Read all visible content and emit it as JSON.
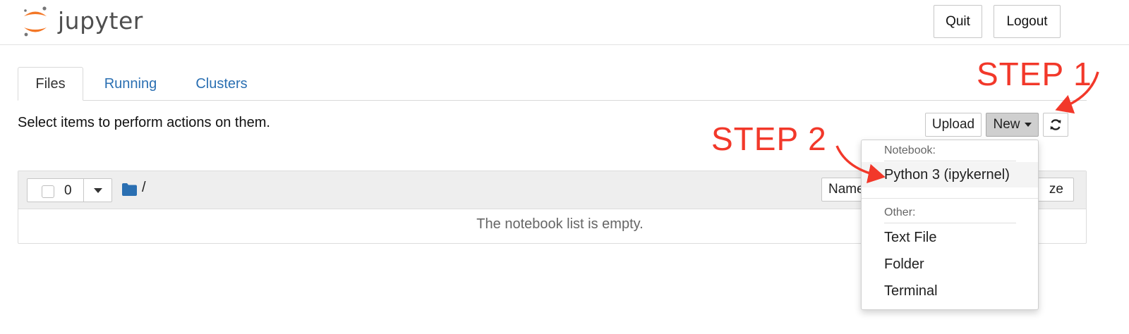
{
  "header": {
    "logo_text": "jupyter",
    "quit_label": "Quit",
    "logout_label": "Logout"
  },
  "tabs": [
    {
      "label": "Files"
    },
    {
      "label": "Running"
    },
    {
      "label": "Clusters"
    }
  ],
  "toolbar": {
    "instructions": "Select items to perform actions on them.",
    "upload_label": "Upload",
    "new_label": "New",
    "refresh_icon": "refresh-icon"
  },
  "file_list": {
    "selected_count": "0",
    "path": "/",
    "sort_name_label": "Name",
    "sort_size_label": "ze",
    "empty_message": "The notebook list is empty."
  },
  "new_menu": {
    "notebook_header": "Notebook:",
    "notebook_items": [
      "Python 3 (ipykernel)"
    ],
    "other_header": "Other:",
    "other_items": [
      "Text File",
      "Folder",
      "Terminal"
    ]
  },
  "annotations": {
    "step1": "STEP 1",
    "step2": "STEP 2",
    "color": "#f2382a"
  },
  "colors": {
    "link": "#2a6fb2",
    "logo_orange": "#f37726",
    "folder_blue": "#2a6fb2"
  }
}
